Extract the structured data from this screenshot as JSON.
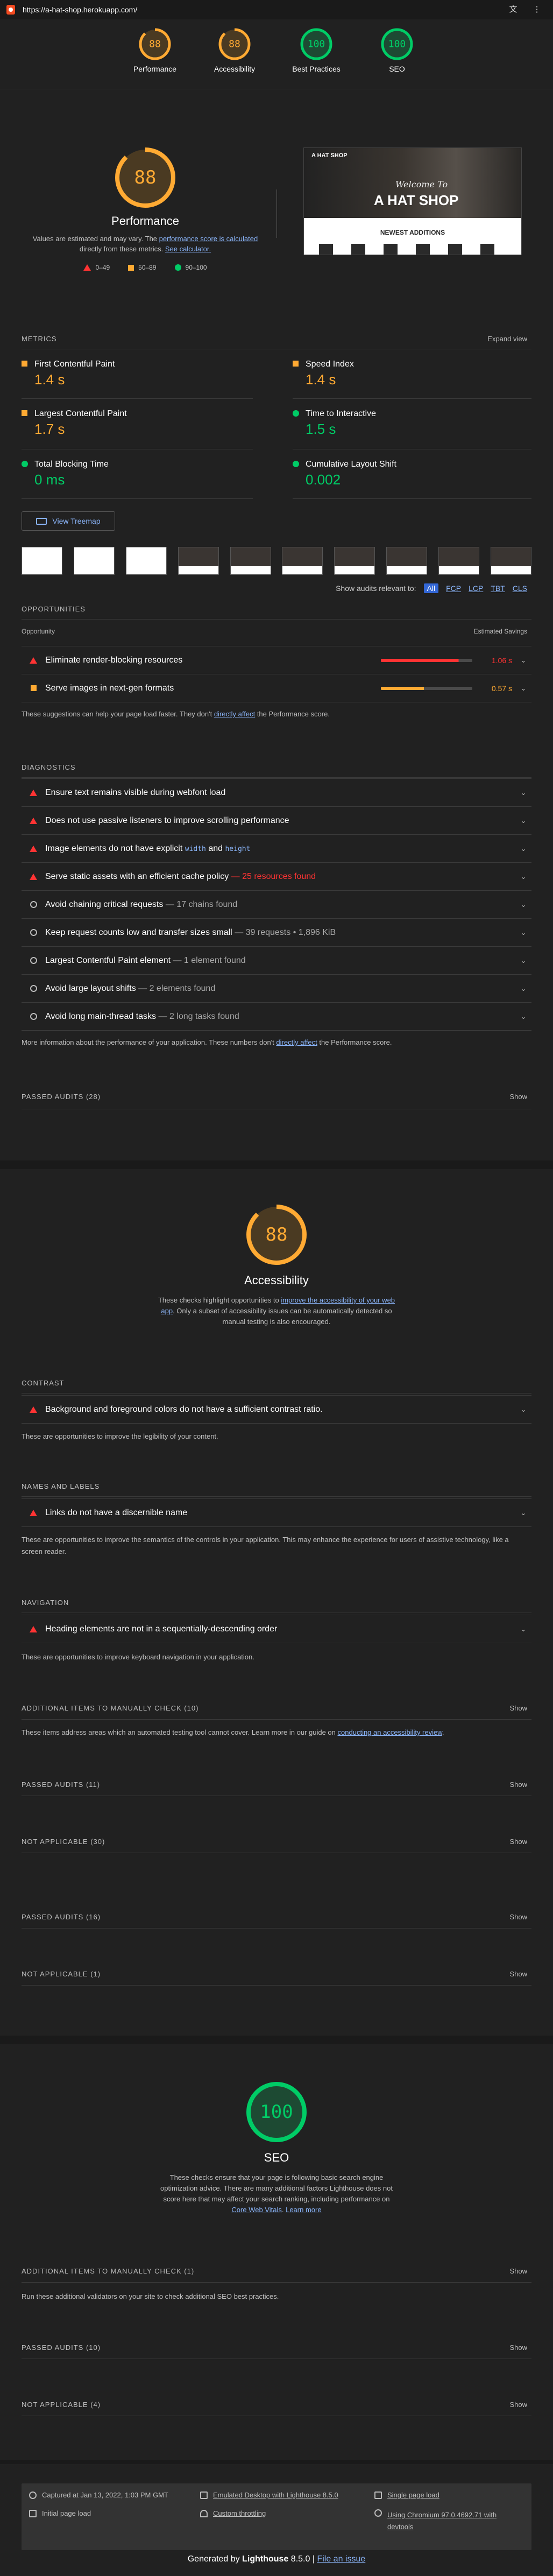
{
  "browser": {
    "url": "https://a-hat-shop.herokuapp.com/",
    "translate_icon": "translate-icon",
    "menu_icon": "more-vert-icon"
  },
  "summary_gauges": [
    {
      "label": "Performance",
      "score": "88",
      "color": "#ffaa33",
      "track": "#4a3a22",
      "fraction": 0.88
    },
    {
      "label": "Accessibility",
      "score": "88",
      "color": "#ffaa33",
      "track": "#4a3a22",
      "fraction": 0.88
    },
    {
      "label": "Best Practices",
      "score": "100",
      "color": "#00cc66",
      "track": "#1d4a33",
      "fraction": 1.0
    },
    {
      "label": "SEO",
      "score": "100",
      "color": "#00cc66",
      "track": "#1d4a33",
      "fraction": 1.0
    }
  ],
  "performance": {
    "score": "88",
    "title": "Performance",
    "note_1": "Values are estimated and may vary. The",
    "note_link_1": "performance score is calculated",
    "note_2": "directly from these metrics.",
    "note_link_2": "See calculator.",
    "legend": {
      "fail": "0–49",
      "average": "50–89",
      "pass": "90–100"
    }
  },
  "screenshot": {
    "brand": "A HAT SHOP",
    "welcome": "Welcome To",
    "headline": "A HAT SHOP",
    "newest": "NEWEST ADDITIONS"
  },
  "metrics": {
    "header": "Metrics",
    "expand": "Expand view",
    "items": [
      {
        "name": "First Contentful Paint",
        "value": "1.4 s"
      },
      {
        "name": "Speed Index",
        "value": "1.4 s"
      },
      {
        "name": "Largest Contentful Paint",
        "value": "1.7 s"
      },
      {
        "name": "Time to Interactive",
        "value": "1.5 s"
      },
      {
        "name": "Total Blocking Time",
        "value": "0 ms"
      },
      {
        "name": "Cumulative Layout Shift",
        "value": "0.002"
      }
    ]
  },
  "treemap_label": "View Treemap",
  "filter": {
    "label": "Show audits relevant to:",
    "all": "All",
    "fcp": "FCP",
    "lcp": "LCP",
    "tbt": "TBT",
    "cls": "CLS"
  },
  "opportunities": {
    "header": "Opportunities",
    "col_left": "Opportunity",
    "col_right": "Estimated Savings",
    "items": [
      {
        "title": "Eliminate render-blocking resources",
        "saving": "1.06 s",
        "fraction": 0.85
      },
      {
        "title": "Serve images in next-gen formats",
        "saving": "0.57 s",
        "fraction": 0.47
      }
    ],
    "footer_1": "These suggestions can help your page load faster. They don't",
    "footer_link": "directly affect",
    "footer_2": "the Performance score."
  },
  "diagnostics": {
    "header": "Diagnostics",
    "items": [
      {
        "title": "Ensure text remains visible during webfont load",
        "extra": ""
      },
      {
        "title": "Does not use passive listeners to improve scrolling performance",
        "extra": ""
      },
      {
        "title_a": "Image elements do not have explicit",
        "code_1": "width",
        "and": "and",
        "code_2": "height"
      },
      {
        "title": "Serve static assets with an efficient cache policy",
        "extra": "— 25 resources found"
      },
      {
        "title": "Avoid chaining critical requests",
        "extra": "— 17 chains found"
      },
      {
        "title": "Keep request counts low and transfer sizes small",
        "extra": "— 39 requests • 1,896 KiB"
      },
      {
        "title": "Largest Contentful Paint element",
        "extra": "— 1 element found"
      },
      {
        "title": "Avoid large layout shifts",
        "extra": "— 2 elements found"
      },
      {
        "title": "Avoid long main-thread tasks",
        "extra": "— 2 long tasks found"
      }
    ],
    "footer_1": "More information about the performance of your application. These numbers don't",
    "footer_link": "directly affect",
    "footer_2": "the Performance score."
  },
  "perf_passed": {
    "label": "Passed audits (28)",
    "action": "Show"
  },
  "accessibility": {
    "score": "88",
    "title": "Accessibility",
    "desc_1": "These checks highlight opportunities to",
    "desc_link": "improve the accessibility of your web app",
    "desc_2": ". Only a subset of accessibility issues can be automatically detected so manual testing is also encouraged.",
    "groups": [
      {
        "header": "Contrast",
        "item": "Background and foreground colors do not have a sufficient contrast ratio.",
        "desc": "These are opportunities to improve the legibility of your content."
      },
      {
        "header": "Names and labels",
        "item": "Links do not have a discernible name",
        "desc": "These are opportunities to improve the semantics of the controls in your application. This may enhance the experience for users of assistive technology, like a screen reader."
      },
      {
        "header": "Navigation",
        "item": "Heading elements are not in a sequentially-descending order",
        "desc": "These are opportunities to improve keyboard navigation in your application."
      }
    ],
    "manual": {
      "label": "Additional items to manually check (10)",
      "action": "Show",
      "desc_1": "These items address areas which an automated testing tool cannot cover. Learn more in our guide on",
      "desc_link": "conducting an accessibility review",
      "desc_2": "."
    },
    "passed": {
      "label": "Passed audits (11)",
      "action": "Show"
    },
    "na": {
      "label": "Not applicable (30)",
      "action": "Show"
    }
  },
  "best_practices": {
    "passed": {
      "label": "Passed audits (16)",
      "action": "Show"
    },
    "na": {
      "label": "Not applicable (1)",
      "action": "Show"
    }
  },
  "seo": {
    "score": "100",
    "title": "SEO",
    "desc_1": "These checks ensure that your page is following basic search engine optimization advice. There are many additional factors Lighthouse does not score here that may affect your search ranking, including performance on",
    "desc_link_1": "Core Web Vitals",
    "desc_link_2": "Learn more",
    "manual": {
      "label": "Additional items to manually check (1)",
      "action": "Show",
      "desc": "Run these additional validators on your site to check additional SEO best practices."
    },
    "passed": {
      "label": "Passed audits (10)",
      "action": "Show"
    },
    "na": {
      "label": "Not applicable (4)",
      "action": "Show"
    }
  },
  "footer": {
    "captured": "Captured at Jan 13, 2022, 1:03 PM GMT",
    "emulated": "Emulated Desktop with Lighthouse 8.5.0",
    "single": "Single page load",
    "initial": "Initial page load",
    "throttling": "Custom throttling",
    "chromium_1": "Using Chromium 97.0.4692.71 with",
    "chromium_2": "devtools",
    "generated_by": "Generated by",
    "lighthouse": "Lighthouse",
    "version": "8.5.0 |",
    "file_issue": "File an issue"
  }
}
